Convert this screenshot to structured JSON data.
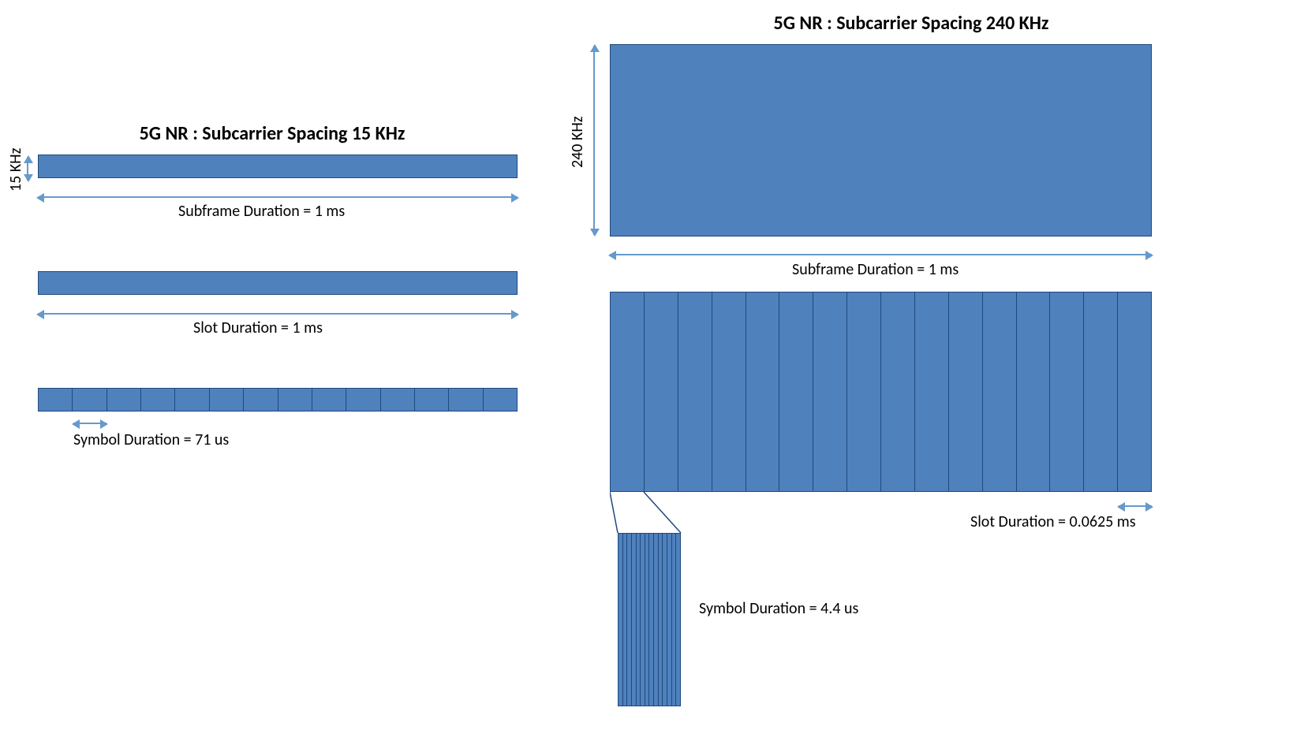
{
  "left": {
    "title": "5G NR : Subcarrier Spacing 15 KHz",
    "freq_label": "15 KHz",
    "subframe_label": "Subframe Duration = 1 ms",
    "slot_label": "Slot Duration = 1 ms",
    "symbol_label": "Symbol Duration = 71 us",
    "symbols_per_slot": 14
  },
  "right": {
    "title": "5G NR : Subcarrier Spacing 240 KHz",
    "freq_label": "240 KHz",
    "subframe_label": "Subframe Duration = 1 ms",
    "slot_label": "Slot Duration = 0.0625 ms",
    "symbol_label": "Symbol Duration = 4.4 us",
    "slots_per_subframe": 16,
    "symbols_per_slot": 14
  }
}
